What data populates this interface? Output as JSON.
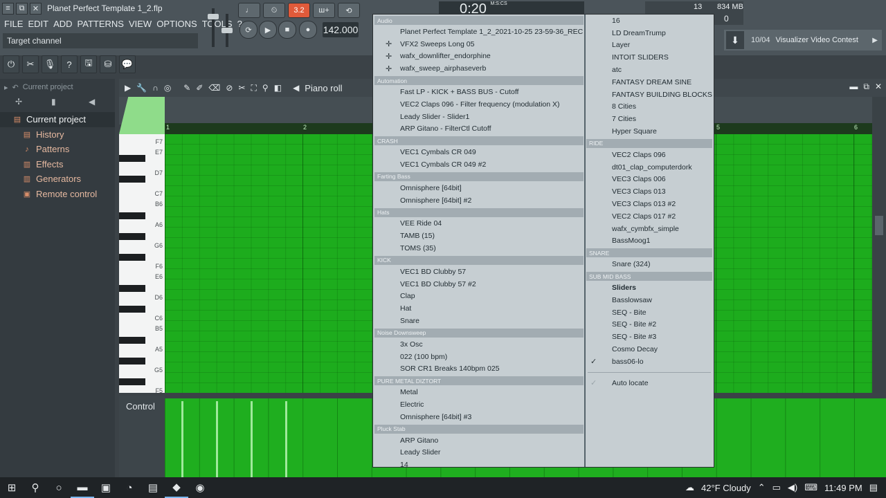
{
  "window": {
    "title": "Planet Perfect Template 1_2.flp",
    "buttons": [
      "≡",
      "⧉",
      "✕"
    ]
  },
  "menubar": [
    "FILE",
    "EDIT",
    "ADD",
    "PATTERNS",
    "VIEW",
    "OPTIONS",
    "TOOLS",
    "?"
  ],
  "hint": "Target channel",
  "transport": {
    "pattern_label": "3.2",
    "tempo": "142.000",
    "time": "0:20",
    "time_unit": "M:S:CS"
  },
  "status": {
    "cpu": "13",
    "memory": "834 MB",
    "polyphony": "0"
  },
  "news": {
    "date": "10/04",
    "text": "Visualizer Video Contest"
  },
  "browser": {
    "header": "Current project",
    "items": [
      {
        "label": "Current project",
        "icon": "folder-icon",
        "root": true
      },
      {
        "label": "History",
        "icon": "history-icon"
      },
      {
        "label": "Patterns",
        "icon": "patterns-icon"
      },
      {
        "label": "Effects",
        "icon": "effects-icon"
      },
      {
        "label": "Generators",
        "icon": "generators-icon"
      },
      {
        "label": "Remote control",
        "icon": "remote-icon"
      }
    ]
  },
  "piano_roll": {
    "title": "Piano roll",
    "bar_numbers": [
      "1",
      "2",
      "5",
      "6"
    ],
    "keys": [
      "F7",
      "E7",
      "D7",
      "C7",
      "B6",
      "A6",
      "G6",
      "F6",
      "E6",
      "D6",
      "C6",
      "B5",
      "A5",
      "G5",
      "F5"
    ],
    "control_label": "Control"
  },
  "menu": {
    "left_column": [
      {
        "type": "header",
        "label": "Audio"
      },
      {
        "type": "item",
        "label": "Planet Perfect Template 1_2_2021-10-25 23-59-36_REC"
      },
      {
        "type": "item",
        "label": "VFX2 Sweeps Long 05",
        "icon": true
      },
      {
        "type": "item",
        "label": "wafx_downlifter_endorphine",
        "icon": true
      },
      {
        "type": "item",
        "label": "wafx_sweep_airphaseverb",
        "icon": true
      },
      {
        "type": "header",
        "label": "Automation"
      },
      {
        "type": "item",
        "label": "Fast LP - KICK + BASS BUS - Cutoff"
      },
      {
        "type": "item",
        "label": "VEC2 Claps 096 - Filter frequency (modulation X)"
      },
      {
        "type": "item",
        "label": "Leady Slider - Slider1"
      },
      {
        "type": "item",
        "label": "ARP Gitano - FilterCtl Cutoff"
      },
      {
        "type": "header",
        "label": "CRASH"
      },
      {
        "type": "item",
        "label": "VEC1 Cymbals CR 049"
      },
      {
        "type": "item",
        "label": "VEC1 Cymbals CR 049 #2"
      },
      {
        "type": "header",
        "label": "Farting Bass"
      },
      {
        "type": "item",
        "label": "Omnisphere [64bit]"
      },
      {
        "type": "item",
        "label": "Omnisphere [64bit] #2"
      },
      {
        "type": "header",
        "label": "Hats"
      },
      {
        "type": "item",
        "label": "VEE Ride 04"
      },
      {
        "type": "item",
        "label": "TAMB (15)"
      },
      {
        "type": "item",
        "label": "TOMS (35)"
      },
      {
        "type": "header",
        "label": "KICK"
      },
      {
        "type": "item",
        "label": "VEC1 BD Clubby 57"
      },
      {
        "type": "item",
        "label": "VEC1 BD Clubby 57 #2"
      },
      {
        "type": "item",
        "label": "Clap"
      },
      {
        "type": "item",
        "label": "Hat"
      },
      {
        "type": "item",
        "label": "Snare"
      },
      {
        "type": "header",
        "label": "Noise Downsweep"
      },
      {
        "type": "item",
        "label": "3x Osc"
      },
      {
        "type": "item",
        "label": "022 (100 bpm)"
      },
      {
        "type": "item",
        "label": "SOR CR1 Breaks 140bpm 025"
      },
      {
        "type": "header",
        "label": "PURE METAL DIZTORT"
      },
      {
        "type": "item",
        "label": "Metal"
      },
      {
        "type": "item",
        "label": "Electric"
      },
      {
        "type": "item",
        "label": "Omnisphere [64bit] #3"
      },
      {
        "type": "header",
        "label": "Pluck Stab"
      },
      {
        "type": "item",
        "label": "ARP Gitano"
      },
      {
        "type": "item",
        "label": "Leady Slider"
      },
      {
        "type": "item",
        "label": "14"
      }
    ],
    "right_column": [
      {
        "type": "item",
        "label": "16"
      },
      {
        "type": "item",
        "label": "LD DreamTrump"
      },
      {
        "type": "item",
        "label": "Layer"
      },
      {
        "type": "item",
        "label": "INTOIT SLIDERS"
      },
      {
        "type": "item",
        "label": "atc"
      },
      {
        "type": "item",
        "label": "FANTASY DREAM SINE"
      },
      {
        "type": "item",
        "label": "FANTASY BUILDING BLOCKS"
      },
      {
        "type": "item",
        "label": "8 Cities"
      },
      {
        "type": "item",
        "label": "7 Cities"
      },
      {
        "type": "item",
        "label": "Hyper Square"
      },
      {
        "type": "header",
        "label": "RIDE"
      },
      {
        "type": "item",
        "label": "VEC2 Claps 096"
      },
      {
        "type": "item",
        "label": "dt01_clap_computerdork"
      },
      {
        "type": "item",
        "label": "VEC3 Claps 006"
      },
      {
        "type": "item",
        "label": "VEC3 Claps 013"
      },
      {
        "type": "item",
        "label": "VEC3 Claps 013 #2"
      },
      {
        "type": "item",
        "label": "VEC2 Claps 017 #2"
      },
      {
        "type": "item",
        "label": "wafx_cymbfx_simple"
      },
      {
        "type": "item",
        "label": "BassMoog1"
      },
      {
        "type": "header",
        "label": "SNARE"
      },
      {
        "type": "item",
        "label": "Snare (324)"
      },
      {
        "type": "header",
        "label": "SUB MID BASS"
      },
      {
        "type": "item",
        "label": "Sliders",
        "bold": true
      },
      {
        "type": "item",
        "label": "Basslowsaw"
      },
      {
        "type": "item",
        "label": "SEQ - Bite"
      },
      {
        "type": "item",
        "label": "SEQ - Bite #2"
      },
      {
        "type": "item",
        "label": "SEQ - Bite #3"
      },
      {
        "type": "item",
        "label": "Cosmo Decay"
      },
      {
        "type": "item",
        "label": "bass06-lo",
        "checked": true
      },
      {
        "type": "separator"
      },
      {
        "type": "item",
        "label": "Auto locate",
        "checked": true,
        "faded_check": true
      }
    ]
  },
  "taskbar": {
    "apps": [
      "windows-start-icon",
      "search-icon",
      "cortana-icon",
      "file-explorer-icon",
      "photoshop-icon",
      "edge-icon",
      "terminal-icon",
      "fl-studio-icon",
      "chrome-icon"
    ],
    "weather": "42°F  Cloudy",
    "time": "11:49 PM"
  },
  "colors": {
    "grid_green": "#1dac1d",
    "menu_bg": "#c6ced2",
    "menu_header": "#a2acb2",
    "panel_dark": "#343b40"
  }
}
